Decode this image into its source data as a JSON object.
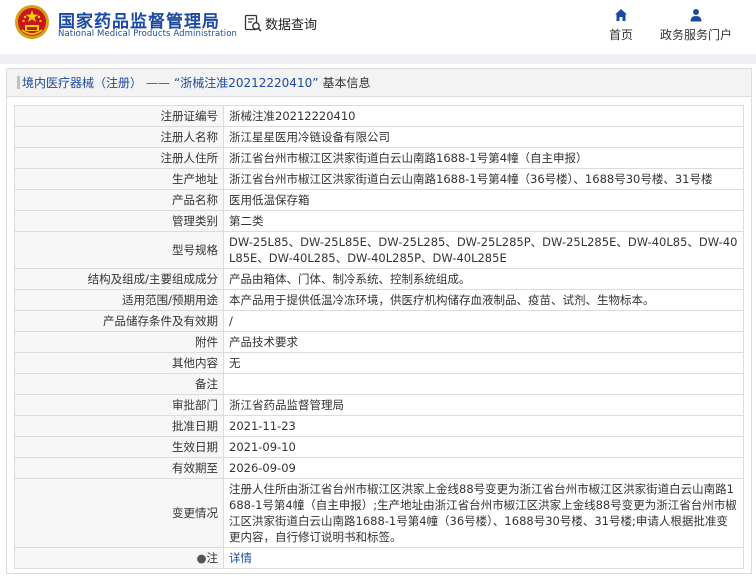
{
  "header": {
    "logo_cn": "国家药品监督管理局",
    "logo_en": "National Medical Products Administration",
    "search_label": "数据查询",
    "nav": [
      {
        "icon": "home-icon",
        "label": "首页"
      },
      {
        "icon": "user-icon",
        "label": "政务服务门户"
      }
    ]
  },
  "panel": {
    "breadcrumb": "境内医疗器械（注册）",
    "separator": "——",
    "record_name": "“浙械注准20212220410”",
    "title_suffix": "基本信息"
  },
  "rows": [
    {
      "label": "注册证编号",
      "value": "浙械注准20212220410"
    },
    {
      "label": "注册人名称",
      "value": "浙江星星医用冷链设备有限公司"
    },
    {
      "label": "注册人住所",
      "value": "浙江省台州市椒江区洪家街道白云山南路1688-1号第4幢（自主申报）"
    },
    {
      "label": "生产地址",
      "value": "浙江省台州市椒江区洪家街道白云山南路1688-1号第4幢（36号楼）、1688号30号楼、31号楼"
    },
    {
      "label": "产品名称",
      "value": "医用低温保存箱"
    },
    {
      "label": "管理类别",
      "value": "第二类"
    },
    {
      "label": "型号规格",
      "value": "DW-25L85、DW-25L85E、DW-25L285、DW-25L285P、DW-25L285E、DW-40L85、DW-40L85E、DW-40L285、DW-40L285P、DW-40L285E"
    },
    {
      "label": "结构及组成/主要组成成分",
      "value": "产品由箱体、门体、制冷系统、控制系统组成。"
    },
    {
      "label": "适用范围/预期用途",
      "value": "本产品用于提供低温冷冻环境，供医疗机构储存血液制品、疫苗、试剂、生物标本。"
    },
    {
      "label": "产品储存条件及有效期",
      "value": "/"
    },
    {
      "label": "附件",
      "value": "产品技术要求"
    },
    {
      "label": "其他内容",
      "value": "无"
    },
    {
      "label": "备注",
      "value": ""
    },
    {
      "label": "审批部门",
      "value": "浙江省药品监督管理局"
    },
    {
      "label": "批准日期",
      "value": "2021-11-23"
    },
    {
      "label": "生效日期",
      "value": "2021-09-10"
    },
    {
      "label": "有效期至",
      "value": "2026-09-09"
    },
    {
      "label": "变更情况",
      "value": "注册人住所由浙江省台州市椒江区洪家上金线88号变更为浙江省台州市椒江区洪家街道白云山南路1688-1号第4幢（自主申报）;生产地址由浙江省台州市椒江区洪家上金线88号变更为浙江省台州市椒江区洪家街道白云山南路1688-1号第4幢（36号楼）、1688号30号楼、31号楼;申请人根据批准变更内容，自行修订说明书和标签。"
    }
  ],
  "note_row": {
    "label": "注",
    "icon": "bulb-icon",
    "link": "详情"
  }
}
